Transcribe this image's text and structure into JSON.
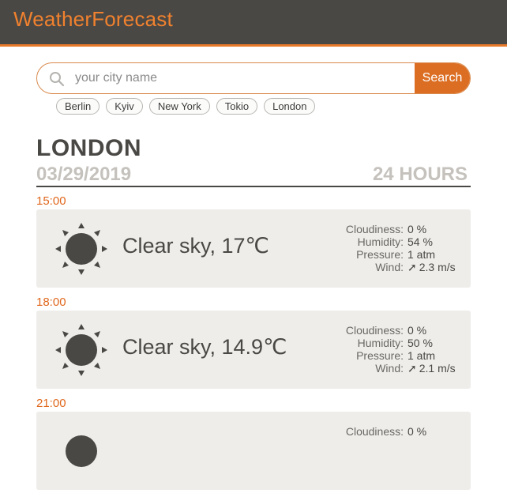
{
  "app": {
    "title": "WeatherForecast"
  },
  "search": {
    "placeholder": "your city name",
    "button_label": "Search"
  },
  "quick_cities": [
    "Berlin",
    "Kyiv",
    "New York",
    "Tokio",
    "London"
  ],
  "header": {
    "city": "LONDON",
    "date": "03/29/2019",
    "range": "24 HOURS"
  },
  "labels": {
    "cloudiness": "Cloudiness:",
    "humidity": "Humidity:",
    "pressure": "Pressure:",
    "wind": "Wind:"
  },
  "forecasts": [
    {
      "time": "15:00",
      "condition": "Clear sky, 17℃",
      "cloudiness": "0 %",
      "humidity": "54 %",
      "pressure": "1 atm",
      "wind": "2.3 m/s",
      "wind_arrow": "➚",
      "icon": "sun-icon"
    },
    {
      "time": "18:00",
      "condition": "Clear sky, 14.9℃",
      "cloudiness": "0 %",
      "humidity": "50 %",
      "pressure": "1 atm",
      "wind": "2.1 m/s",
      "wind_arrow": "➚",
      "icon": "sun-icon"
    },
    {
      "time": "21:00",
      "condition": "",
      "cloudiness": "0 %",
      "humidity": "",
      "pressure": "",
      "wind": "",
      "wind_arrow": "",
      "icon": "sun-icon"
    }
  ],
  "colors": {
    "accent": "#dc6e23",
    "header_bg": "#4a4845",
    "card_bg": "#eeedea"
  }
}
